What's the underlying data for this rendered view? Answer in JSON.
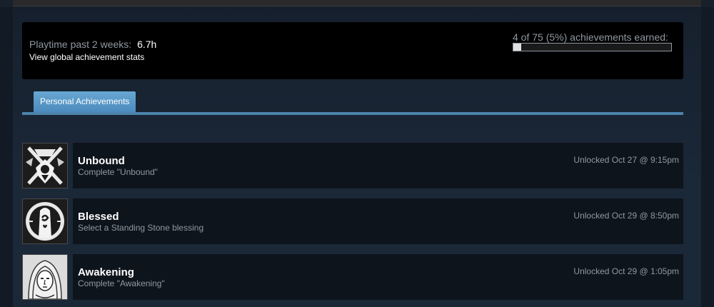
{
  "summary": {
    "playtime_label": "Playtime past 2 weeks:",
    "playtime_value": "6.7h",
    "global_stats_link": "View global achievement stats",
    "earned_text": "4 of 75 (5%) achievements earned:",
    "progress_percent": 5
  },
  "tabs": [
    {
      "label": "Personal Achievements",
      "active": true
    }
  ],
  "achievements": [
    {
      "title": "Unbound",
      "description": "Complete \"Unbound\"",
      "unlocked": "Unlocked Oct 27 @ 9:15pm",
      "icon": "dragon-sword-icon"
    },
    {
      "title": "Blessed",
      "description": "Select a Standing Stone blessing",
      "unlocked": "Unlocked Oct 29 @ 8:50pm",
      "icon": "standing-stone-icon"
    },
    {
      "title": "Awakening",
      "description": "Complete \"Awakening\"",
      "unlocked": "Unlocked Oct 29 @ 1:05pm",
      "icon": "portrait-icon"
    }
  ],
  "colors": {
    "background": "#1b2838",
    "panel": "#000000",
    "row": "#0e141c",
    "tab": "#5b9bc8",
    "muted_text": "#8f98a0"
  }
}
